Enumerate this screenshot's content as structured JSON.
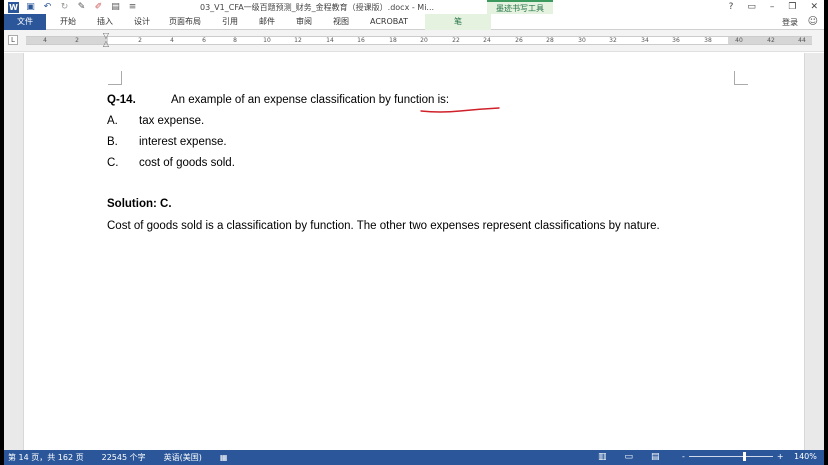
{
  "window": {
    "title": "03_V1_CFA一级百题预测_财务_金程教育（授课版）.docx - Mi...",
    "context_group": "墨迹书写工具",
    "controls": [
      "?",
      "▭",
      "–",
      "❐",
      "✕"
    ]
  },
  "ribbon": {
    "file_tab": "文件",
    "tabs": [
      "开始",
      "插入",
      "设计",
      "页面布局",
      "引用",
      "邮件",
      "审阅",
      "视图",
      "ACROBAT"
    ],
    "context_tab": "笔",
    "login": "登录"
  },
  "ruler": {
    "corner": "L",
    "ticks": [
      "4",
      "2",
      "2",
      "4",
      "6",
      "8",
      "10",
      "12",
      "14",
      "16",
      "18",
      "20",
      "22",
      "24",
      "26",
      "28",
      "30",
      "32",
      "34",
      "36",
      "38",
      "40",
      "42",
      "44"
    ]
  },
  "document": {
    "question_number": "Q-14.",
    "question_text": "An example of an expense classification by function is:",
    "options": [
      {
        "letter": "A.",
        "text": "tax expense."
      },
      {
        "letter": "B.",
        "text": "interest expense."
      },
      {
        "letter": "C.",
        "text": "cost of goods sold."
      }
    ],
    "solution_title": "Solution: C.",
    "solution_body": "Cost of goods sold is a classification by function. The other two expenses represent classifications by nature."
  },
  "statusbar": {
    "page": "第 14 页，共 162 页",
    "words": "22545 个字",
    "language": "英语(美国)",
    "zoom": "140%",
    "zoom_minus": "-",
    "zoom_plus": "+"
  },
  "colors": {
    "accent": "#2b579a",
    "ink": "#d0202a",
    "context": "#217346"
  }
}
